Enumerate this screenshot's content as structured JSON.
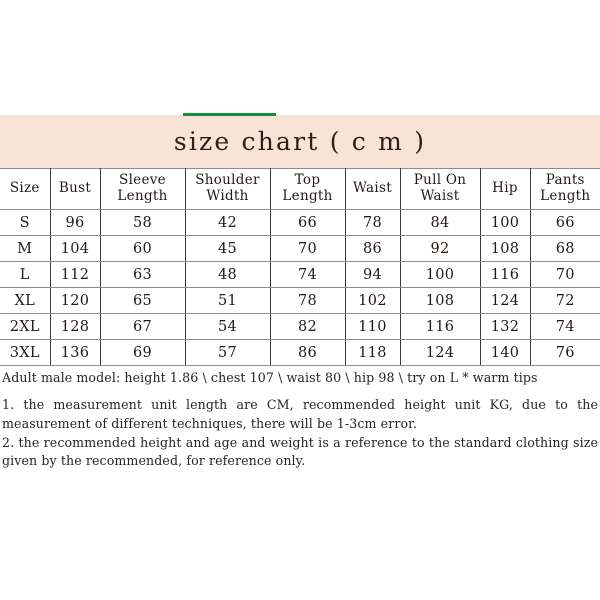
{
  "accent": {
    "color": "#12953a"
  },
  "banner": {
    "title": "size chart ( c m )",
    "background": "#f8e3d6",
    "text_color": "#2a1f1a"
  },
  "chart_data": {
    "type": "table",
    "title": "size chart ( c m )",
    "unit": "cm",
    "columns": [
      "Size",
      "Bust",
      "Sleeve Length",
      "Shoulder Width",
      "Top Length",
      "Waist",
      "Pull On Waist",
      "Hip",
      "Pants Length"
    ],
    "column_lines": [
      [
        "Size",
        ""
      ],
      [
        "Bust",
        ""
      ],
      [
        "Sleeve",
        "Length"
      ],
      [
        "Shoulder",
        "Width"
      ],
      [
        "Top",
        "Length"
      ],
      [
        "Waist",
        ""
      ],
      [
        "Pull On",
        "Waist"
      ],
      [
        "Hip",
        ""
      ],
      [
        "Pants",
        "Length"
      ]
    ],
    "rows": [
      [
        "S",
        "96",
        "58",
        "42",
        "66",
        "78",
        "84",
        "100",
        "66"
      ],
      [
        "M",
        "104",
        "60",
        "45",
        "70",
        "86",
        "92",
        "108",
        "68"
      ],
      [
        "L",
        "112",
        "63",
        "48",
        "74",
        "94",
        "100",
        "116",
        "70"
      ],
      [
        "XL",
        "120",
        "65",
        "51",
        "78",
        "102",
        "108",
        "124",
        "72"
      ],
      [
        "2XL",
        "128",
        "67",
        "54",
        "82",
        "110",
        "116",
        "132",
        "74"
      ],
      [
        "3XL",
        "136",
        "69",
        "57",
        "86",
        "118",
        "124",
        "140",
        "76"
      ]
    ],
    "series": [
      {
        "name": "Bust",
        "values": [
          96,
          104,
          112,
          120,
          128,
          136
        ]
      },
      {
        "name": "Sleeve Length",
        "values": [
          58,
          60,
          63,
          65,
          67,
          69
        ]
      },
      {
        "name": "Shoulder Width",
        "values": [
          42,
          45,
          48,
          51,
          54,
          57
        ]
      },
      {
        "name": "Top Length",
        "values": [
          66,
          70,
          74,
          78,
          82,
          86
        ]
      },
      {
        "name": "Waist",
        "values": [
          78,
          86,
          94,
          102,
          110,
          118
        ]
      },
      {
        "name": "Pull On Waist",
        "values": [
          84,
          92,
          100,
          108,
          116,
          124
        ]
      },
      {
        "name": "Hip",
        "values": [
          100,
          108,
          116,
          124,
          132,
          140
        ]
      },
      {
        "name": "Pants Length",
        "values": [
          66,
          68,
          70,
          72,
          74,
          76
        ]
      }
    ],
    "categories": [
      "S",
      "M",
      "L",
      "XL",
      "2XL",
      "3XL"
    ]
  },
  "notes": {
    "model": "Adult male model: height 1.86 \\ chest 107 \\ waist 80 \\ hip 98 \\ try on L * warm tips",
    "note1": "1. the measurement unit length are CM, recommended height unit KG, due to the measurement of different techniques, there will be 1-3cm error.",
    "note2": "2. the recommended height and age and weight is a reference to the standard clothing size given by the recommended, for reference only."
  }
}
